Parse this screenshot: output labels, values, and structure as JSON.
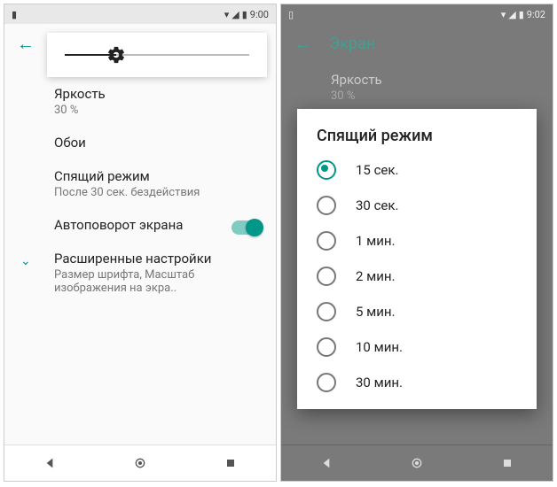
{
  "left": {
    "status": {
      "time": "9:00"
    },
    "brightness": {
      "title": "Яркость",
      "sub": "30 %"
    },
    "wallpaper": {
      "title": "Обои"
    },
    "sleep": {
      "title": "Спящий режим",
      "sub": "После 30 сек. бездействия"
    },
    "autorotate": {
      "title": "Автоповорот экрана"
    },
    "advanced": {
      "title": "Расширенные настройки",
      "sub": "Размер шрифта, Масштаб изображения на экра.."
    }
  },
  "right": {
    "status": {
      "time": "9:02"
    },
    "appbar": {
      "title": "Экран"
    },
    "brightness": {
      "title": "Яркость",
      "sub": "30 %"
    },
    "dialog": {
      "title": "Спящий режим",
      "options": [
        "15 сек.",
        "30 сек.",
        "1 мин.",
        "2 мин.",
        "5 мин.",
        "10 мин.",
        "30 мин."
      ],
      "selected": 0
    }
  },
  "accent": "#009688"
}
